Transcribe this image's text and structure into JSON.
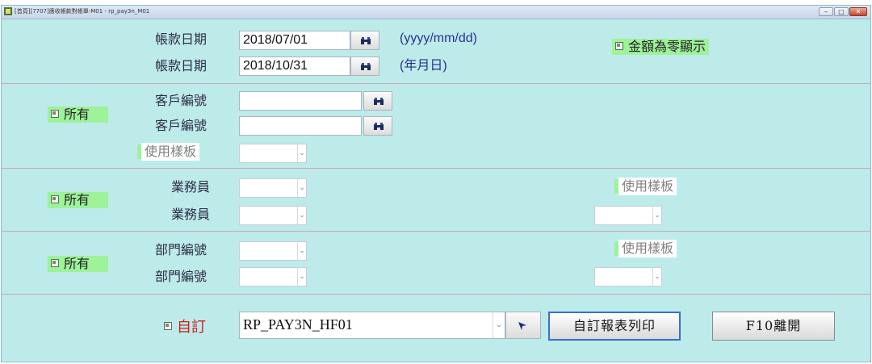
{
  "window": {
    "title": "[首頁][7707]應收帳款對帳單-M01 - rp_pay3n_M01",
    "app_icon": "app-icon",
    "controls": {
      "minimize": "–",
      "maximize": "□",
      "close": "✕"
    }
  },
  "date_section": {
    "label_from": "帳款日期",
    "label_to": "帳款日期",
    "date_from": "2018/07/01",
    "date_to": "2018/10/31",
    "hint_format": "(yyyy/mm/dd)",
    "hint_ymd": "(年月日)",
    "zero_amount_label": "金額為零顯示",
    "picker_icon": "binoculars-icon"
  },
  "customer_section": {
    "all_label": "所有",
    "label_from": "客戶編號",
    "label_to": "客戶編號",
    "value_from": "",
    "value_to": "",
    "template_label": "使用樣板",
    "template_value": ""
  },
  "sales_section": {
    "all_label": "所有",
    "label_from": "業務員",
    "label_to": "業務員",
    "value_from": "",
    "value_to": "",
    "template_label": "使用樣板",
    "template_value": ""
  },
  "dept_section": {
    "all_label": "所有",
    "label_from": "部門編號",
    "label_to": "部門編號",
    "value_from": "",
    "value_to": "",
    "template_label": "使用樣板",
    "template_value": ""
  },
  "report_section": {
    "custom_label": "自訂",
    "report_name": "RP_PAY3N_HF01",
    "print_button": "自訂報表列印",
    "exit_button": "F10離開"
  },
  "colors": {
    "background": "#bdebea",
    "checkbox_highlight": "#9ef29a",
    "hint_text": "#27318f",
    "custom_label": "#d11b1b"
  }
}
